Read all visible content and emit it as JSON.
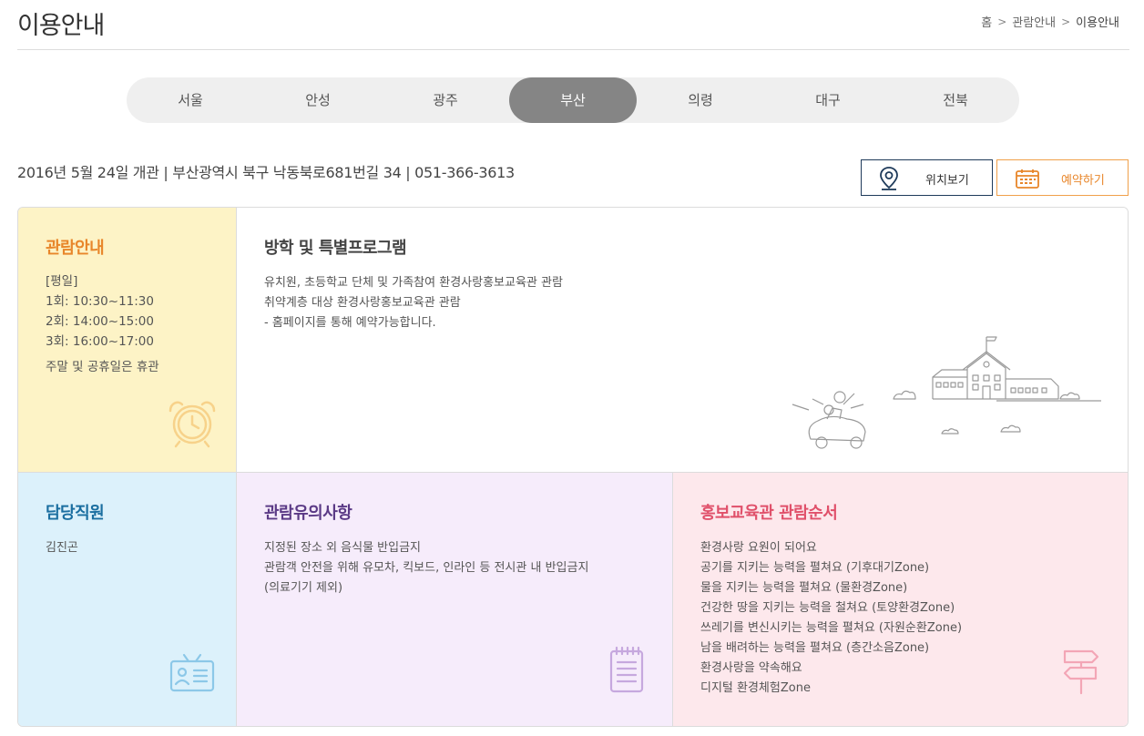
{
  "header": {
    "title": "이용안내",
    "breadcrumb": [
      "홈",
      "관람안내",
      "이용안내"
    ]
  },
  "tabs": {
    "items": [
      "서울",
      "안성",
      "광주",
      "부산",
      "의령",
      "대구",
      "전북"
    ],
    "active": "부산"
  },
  "info": {
    "summary": "2016년 5월 24일 개관 | 부산광역시 북구 낙동북로681번길 34 | 051-366-3613",
    "location_button": "위치보기",
    "reserve_button": "예약하기"
  },
  "hours": {
    "title": "관람안내",
    "lines": [
      "[평일]",
      "1회: 10:30~11:30",
      "2회: 14:00~15:00",
      "3회: 16:00~17:00"
    ],
    "closed": "주말 및 공휴일은 휴관"
  },
  "program": {
    "title": "방학 및 특별프로그램",
    "lines": [
      "유치원, 초등학교 단체 및 가족참여 환경사랑홍보교육관 관람",
      "취약계층 대상 환경사랑홍보교육관 관람",
      "- 홈페이지를 통해 예약가능합니다."
    ]
  },
  "staff": {
    "title": "담당직원",
    "name": "김진곤"
  },
  "notice": {
    "title": "관람유의사항",
    "lines": [
      "지정된 장소 외 음식물 반입금지",
      "관람객 안전을 위해 유모차, 킥보드, 인라인 등 전시관 내 반입금지",
      "(의료기기 제외)"
    ]
  },
  "order": {
    "title": "홍보교육관 관람순서",
    "lines": [
      "환경사랑 요원이 되어요",
      "공기를 지키는 능력을 펼쳐요 (기후대기Zone)",
      "물을 지키는 능력을 펼쳐요 (물환경Zone)",
      "건강한 땅을 지키는 능력을 철쳐요 (토양환경Zone)",
      "쓰레기를 변신시키는 능력을 펼쳐요 (자원순환Zone)",
      "남을 배려하는 능력을 펼쳐요 (층간소음Zone)",
      "환경사랑을 약속해요",
      "디지털 환경체험Zone"
    ]
  },
  "icons": {
    "location": "map-pin-icon",
    "reserve": "calendar-icon",
    "hours": "alarm-clock-icon",
    "staff": "id-card-icon",
    "notice": "notepad-icon",
    "order": "signpost-icon",
    "program": "school-car-illustration"
  },
  "colors": {
    "active_tab": "#858585",
    "hours_bg": "#fdf3c6",
    "staff_bg": "#dcf1fb",
    "notice_bg": "#f6ecfb",
    "order_bg": "#fde8ec",
    "reserve_accent": "#e8862a",
    "location_border": "#1e3a5a"
  }
}
